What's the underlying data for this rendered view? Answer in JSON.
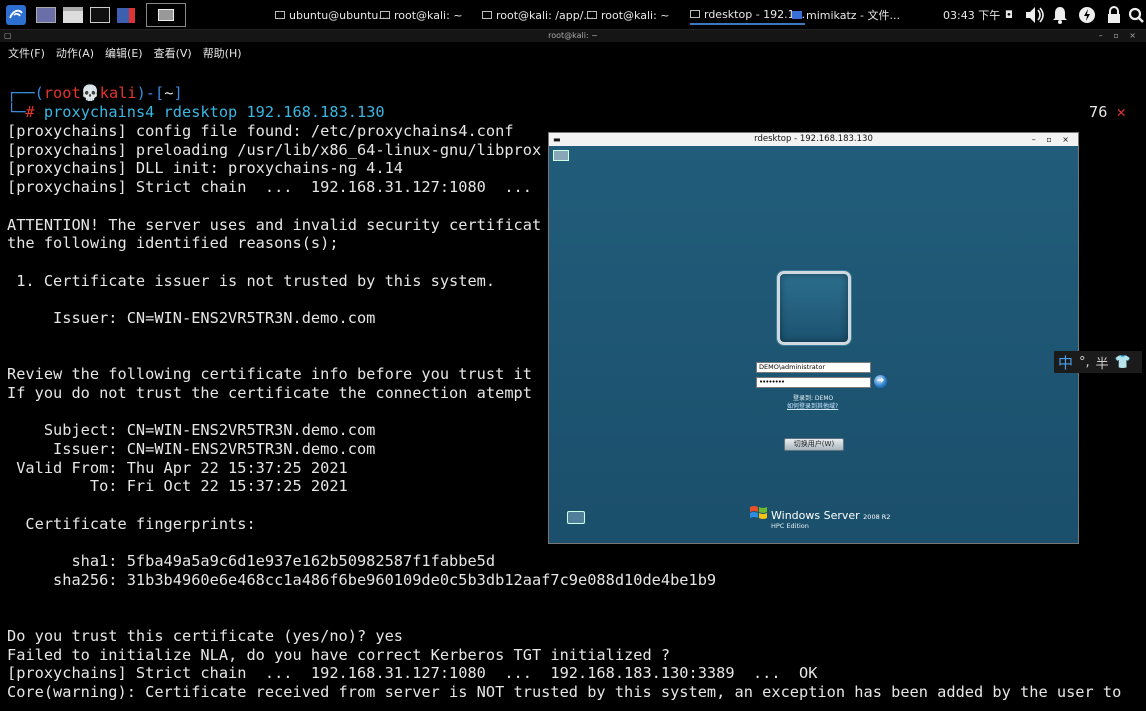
{
  "taskbar": {
    "tasks": [
      {
        "label": "ubuntu@ubuntu..."
      },
      {
        "label": "root@kali: ~"
      },
      {
        "label": "root@kali: /app/..."
      },
      {
        "label": "root@kali: ~"
      },
      {
        "label": "rdesktop - 192.1..."
      },
      {
        "label": "mimikatz - 文件..."
      }
    ],
    "clock": "03:43 下午",
    "icons": [
      "kali-menu-icon",
      "workspace-icon",
      "file-manager-icon",
      "terminal-icon",
      "screen-recorder-icon",
      "volume-icon",
      "notification-bell-icon",
      "power-icon",
      "lock-icon",
      "search-icon"
    ]
  },
  "terminal": {
    "window_title": "root@kali: ~",
    "menu": [
      "文件(F)",
      "动作(A)",
      "编辑(E)",
      "查看(V)",
      "帮助(H)"
    ],
    "prompt": {
      "user": "root",
      "skull": "💀",
      "host": "kali",
      "dir": "~",
      "command": "proxychains4 rdesktop 192.168.183.130"
    },
    "right_status": "76",
    "right_status_mark": "✕",
    "lines": [
      "[proxychains] config file found: /etc/proxychains4.conf",
      "[proxychains] preloading /usr/lib/x86_64-linux-gnu/libprox",
      "[proxychains] DLL init: proxychains-ng 4.14",
      "[proxychains] Strict chain  ...  192.168.31.127:1080  ...",
      "",
      "ATTENTION! The server uses and invalid security certificat",
      "the following identified reasons(s);",
      "",
      " 1. Certificate issuer is not trusted by this system.",
      "",
      "     Issuer: CN=WIN-ENS2VR5TR3N.demo.com",
      "",
      "",
      "Review the following certificate info before you trust it",
      "If you do not trust the certificate the connection atempt",
      "",
      "    Subject: CN=WIN-ENS2VR5TR3N.demo.com",
      "     Issuer: CN=WIN-ENS2VR5TR3N.demo.com",
      " Valid From: Thu Apr 22 15:37:25 2021",
      "         To: Fri Oct 22 15:37:25 2021",
      "",
      "  Certificate fingerprints:",
      "",
      "       sha1: 5fba49a5a9c6d1e937e162b50982587f1fabbe5d",
      "     sha256: 31b3b4960e6e468cc1a486f6be960109de0c5b3db12aaf7c9e088d10de4be1b9",
      "",
      "",
      "Do you trust this certificate (yes/no)? yes",
      "Failed to initialize NLA, do you have correct Kerberos TGT initialized ?",
      "[proxychains] Strict chain  ...  192.168.31.127:1080  ...  192.168.183.130:3389  ...  OK",
      "Core(warning): Certificate received from server is NOT trusted by this system, an exception has been added by the user to"
    ]
  },
  "rdesktop": {
    "title": "rdesktop - 192.168.183.130",
    "username": "DEMO\\administrator",
    "password_mask": "••••••••",
    "login_to": "登录到: DEMO",
    "help_link": "如何登录到其他域?",
    "switch_user": "切换用户(W)",
    "brand": "Windows Server",
    "brand_version": "2008 R2",
    "edition": "HPC Edition"
  },
  "ime": {
    "mode": "中",
    "punct": "°,",
    "width": "半"
  }
}
